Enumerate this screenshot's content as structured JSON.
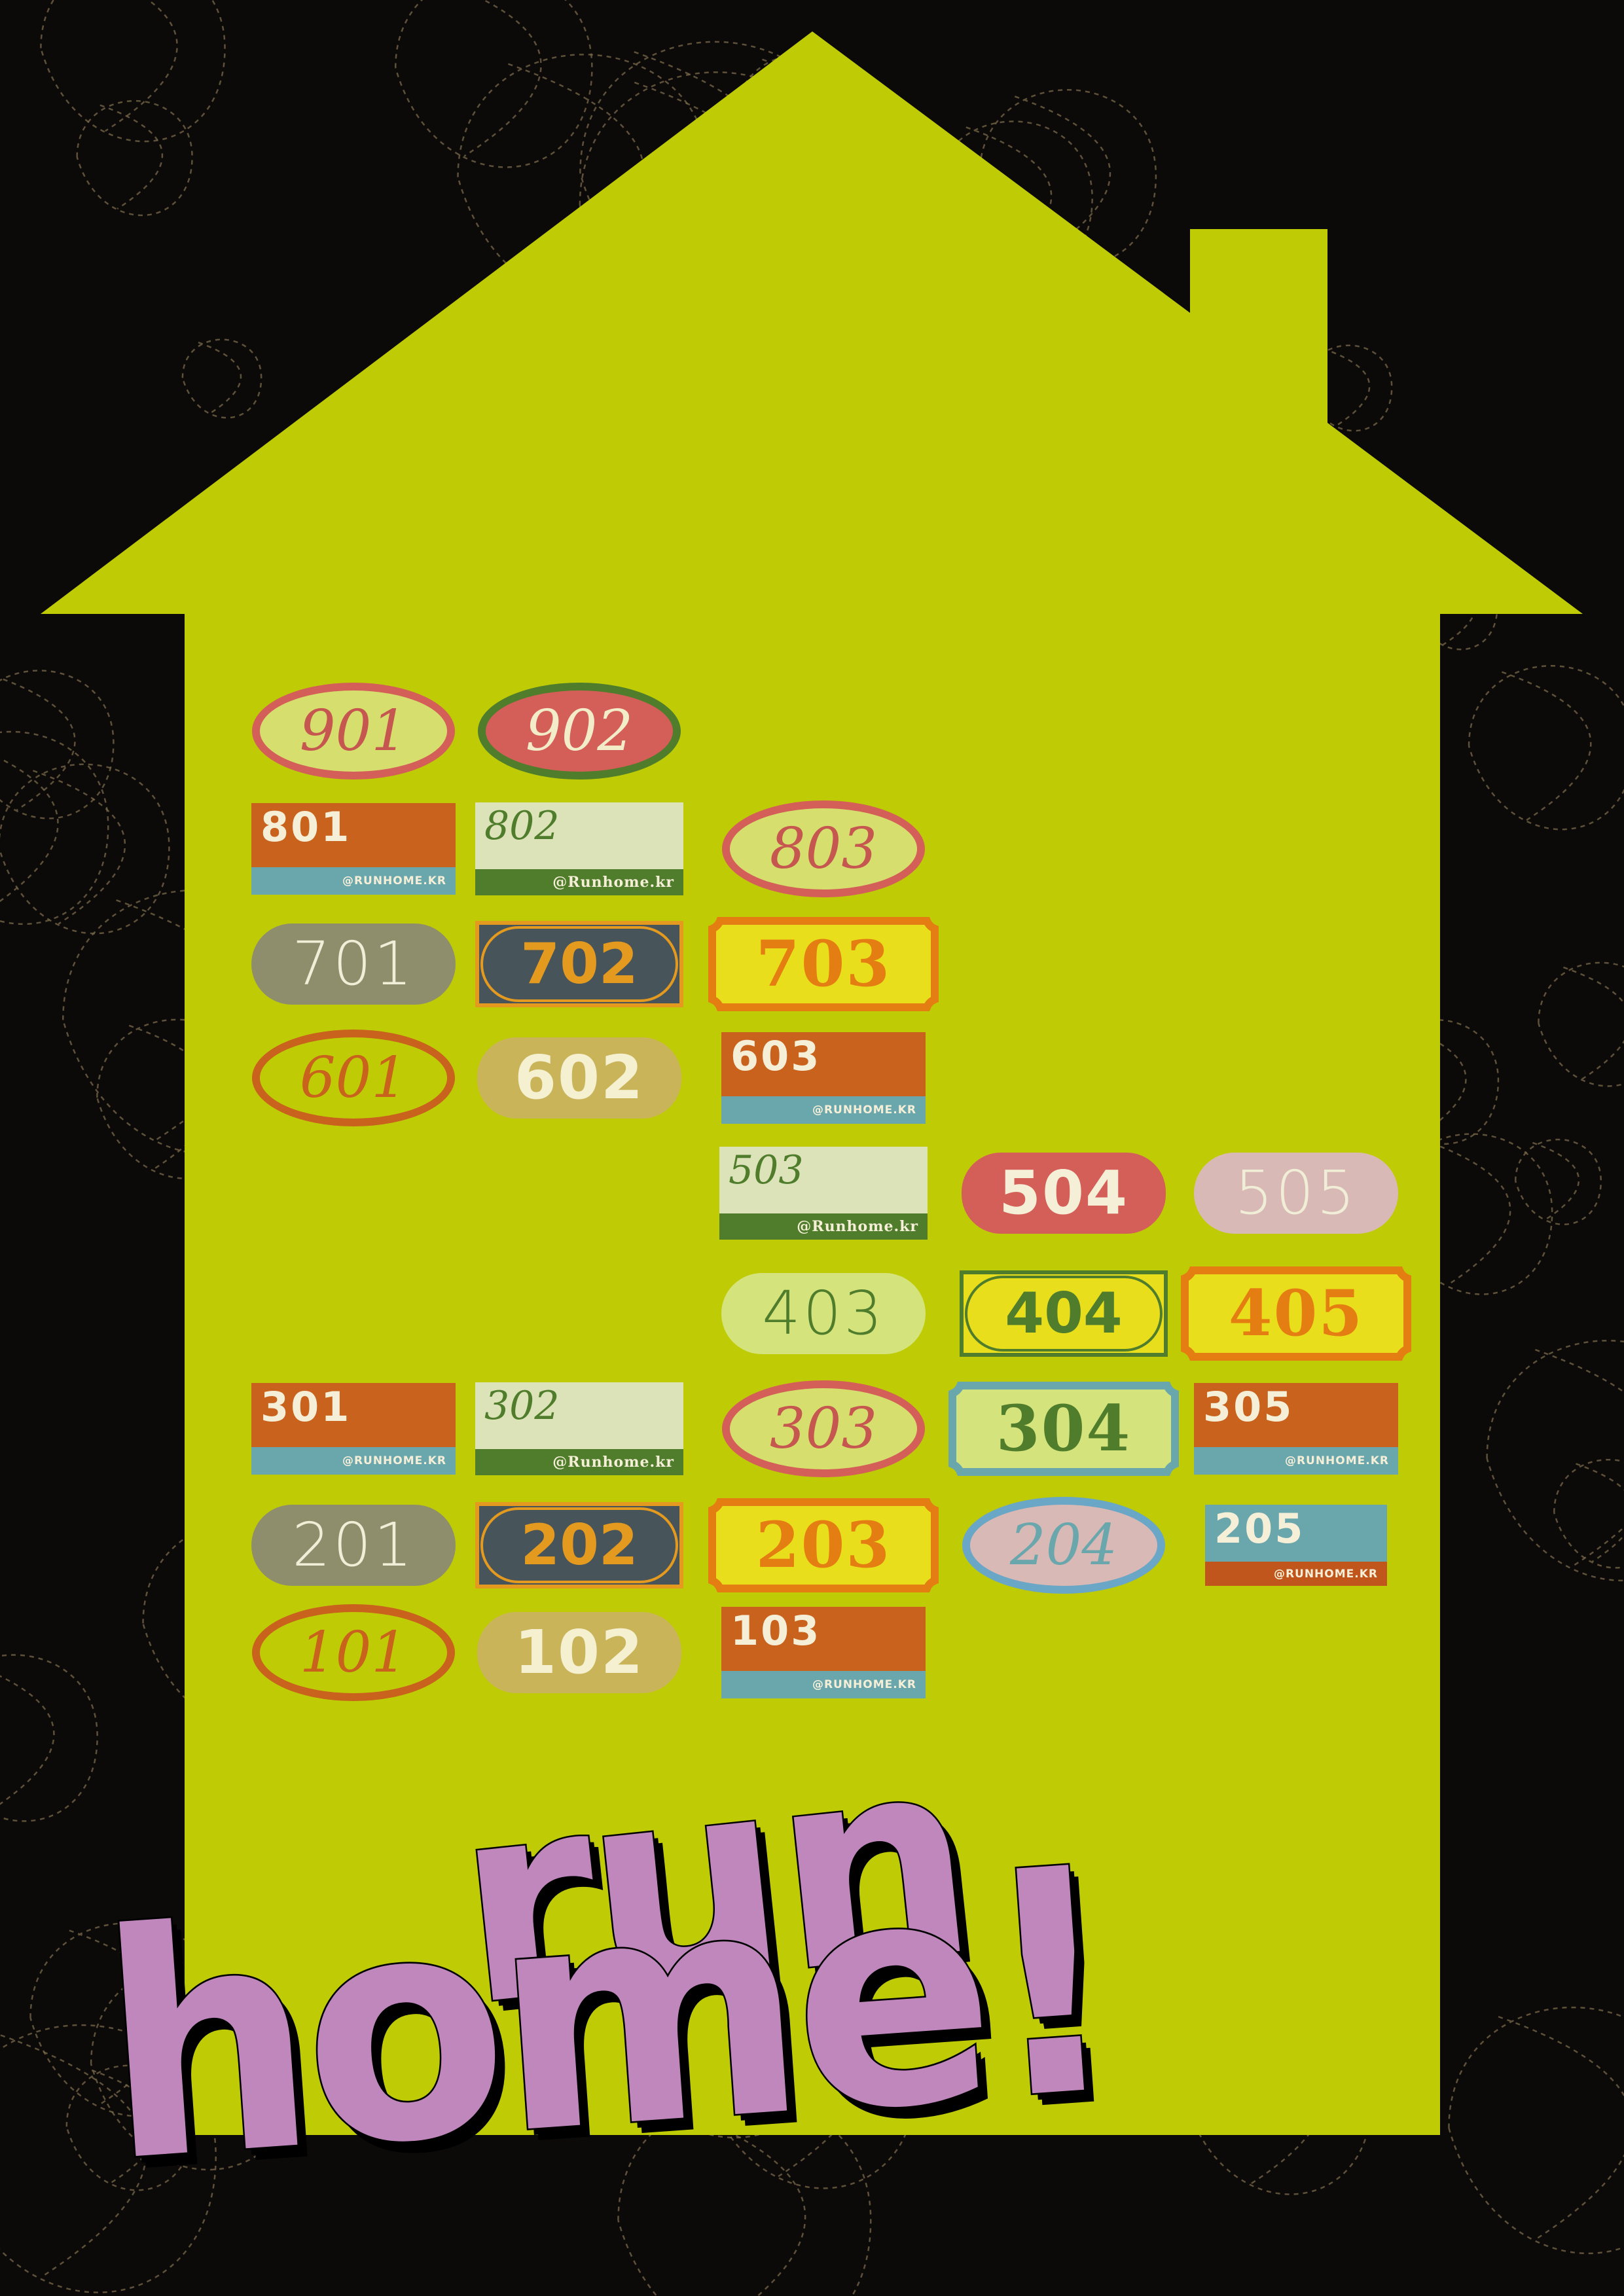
{
  "colors": {
    "background": "#0c0909",
    "pattern": "#7a6a4a",
    "house": "#bfcc05",
    "title_fill": "#c087bd",
    "title_outline": "#000000"
  },
  "title": {
    "line1": "run",
    "line2": "home!"
  },
  "floors": [
    {
      "floor": 9,
      "units": [
        {
          "number": "901",
          "style": "ellipse",
          "fill": "#d6df6e",
          "border": "#d45f58",
          "text": "#c65650"
        },
        {
          "number": "902",
          "style": "ellipse",
          "fill": "#d45f58",
          "border": "#4f7d2c",
          "text": "#f3ecc8"
        }
      ]
    },
    {
      "floor": 8,
      "units": [
        {
          "number": "801",
          "style": "orange-label",
          "fill": "#c8621c",
          "band": "#6aa7ad",
          "text": "#f6efd8",
          "handle": "@RUNHOME.KR"
        },
        {
          "number": "802",
          "style": "cream-label",
          "fill": "#dde3b8",
          "band": "#4f7d2c",
          "text": "#4f7d2c",
          "handle": "@Runhome.kr"
        },
        {
          "number": "803",
          "style": "ellipse",
          "fill": "#d6df6e",
          "border": "#d45f58",
          "text": "#c65650"
        }
      ]
    },
    {
      "floor": 7,
      "units": [
        {
          "number": "701",
          "style": "pill",
          "fill": "#8f8e6c",
          "text": "#f1eed8"
        },
        {
          "number": "702",
          "style": "frame",
          "fill": "#47545a",
          "frame": "#e39a1f",
          "text": "#e39a1f"
        },
        {
          "number": "703",
          "style": "ticket",
          "fill": "#e9de1b",
          "border": "#e57e12",
          "text": "#e57e12"
        }
      ]
    },
    {
      "floor": 6,
      "units": [
        {
          "number": "601",
          "style": "ellipse",
          "fill": "#bfcc05",
          "border": "#c8621c",
          "text": "#c8621c"
        },
        {
          "number": "602",
          "style": "heavy",
          "fill": "#c9b45a",
          "text": "#f4f0d0"
        },
        {
          "number": "603",
          "style": "orange-label",
          "fill": "#c8621c",
          "band": "#6aa7ad",
          "text": "#f6efd8",
          "handle": "@RUNHOME.KR"
        }
      ]
    },
    {
      "floor": 5,
      "units": [
        {
          "number": "503",
          "style": "cream-label",
          "fill": "#dde3b8",
          "band": "#4f7d2c",
          "text": "#4f7d2c",
          "handle": "@Runhome.kr"
        },
        {
          "number": "504",
          "style": "heavy",
          "fill": "#d45f58",
          "text": "#f6efd8"
        },
        {
          "number": "505",
          "style": "pill",
          "fill": "#d9b9b6",
          "text": "#f1eed8"
        }
      ]
    },
    {
      "floor": 4,
      "units": [
        {
          "number": "403",
          "style": "pill",
          "fill": "#d4e37c",
          "text": "#4f7d2c"
        },
        {
          "number": "404",
          "style": "frame",
          "fill": "#e9de1b",
          "frame": "#4f7d2c",
          "text": "#4f7d2c"
        },
        {
          "number": "405",
          "style": "ticket",
          "fill": "#e9de1b",
          "border": "#e57e12",
          "text": "#e57e12"
        }
      ]
    },
    {
      "floor": 3,
      "units": [
        {
          "number": "301",
          "style": "orange-label",
          "fill": "#c8621c",
          "band": "#6aa7ad",
          "text": "#f6efd8",
          "handle": "@RUNHOME.KR"
        },
        {
          "number": "302",
          "style": "cream-label",
          "fill": "#dde3b8",
          "band": "#4f7d2c",
          "text": "#4f7d2c",
          "handle": "@Runhome.kr"
        },
        {
          "number": "303",
          "style": "ellipse",
          "fill": "#d6df6e",
          "border": "#d45f58",
          "text": "#c65650"
        },
        {
          "number": "304",
          "style": "ticket",
          "fill": "#d4e37c",
          "border": "#6aa7ad",
          "text": "#4f7d2c"
        },
        {
          "number": "305",
          "style": "orange-label",
          "fill": "#c8621c",
          "band": "#6aa7ad",
          "text": "#f6efd8",
          "handle": "@RUNHOME.KR"
        }
      ]
    },
    {
      "floor": 2,
      "units": [
        {
          "number": "201",
          "style": "pill",
          "fill": "#8f8e6c",
          "text": "#f1eed8"
        },
        {
          "number": "202",
          "style": "frame",
          "fill": "#47545a",
          "frame": "#e39a1f",
          "text": "#e39a1f"
        },
        {
          "number": "203",
          "style": "ticket",
          "fill": "#e9de1b",
          "border": "#e57e12",
          "text": "#e57e12"
        },
        {
          "number": "204",
          "style": "ellipse",
          "fill": "#d9b9b6",
          "border": "#6aa7c6",
          "text": "#6aa7ad"
        },
        {
          "number": "205",
          "style": "blue-label",
          "fill": "#6aa7ad",
          "band": "#c0561c",
          "text": "#f6efd8",
          "handle": "@RUNHOME.KR"
        }
      ]
    },
    {
      "floor": 1,
      "units": [
        {
          "number": "101",
          "style": "ellipse",
          "fill": "#bfcc05",
          "border": "#c8621c",
          "text": "#c8621c"
        },
        {
          "number": "102",
          "style": "heavy",
          "fill": "#c9b45a",
          "text": "#f4f0d0"
        },
        {
          "number": "103",
          "style": "orange-label",
          "fill": "#c8621c",
          "band": "#6aa7ad",
          "text": "#f6efd8",
          "handle": "@RUNHOME.KR"
        }
      ]
    }
  ]
}
